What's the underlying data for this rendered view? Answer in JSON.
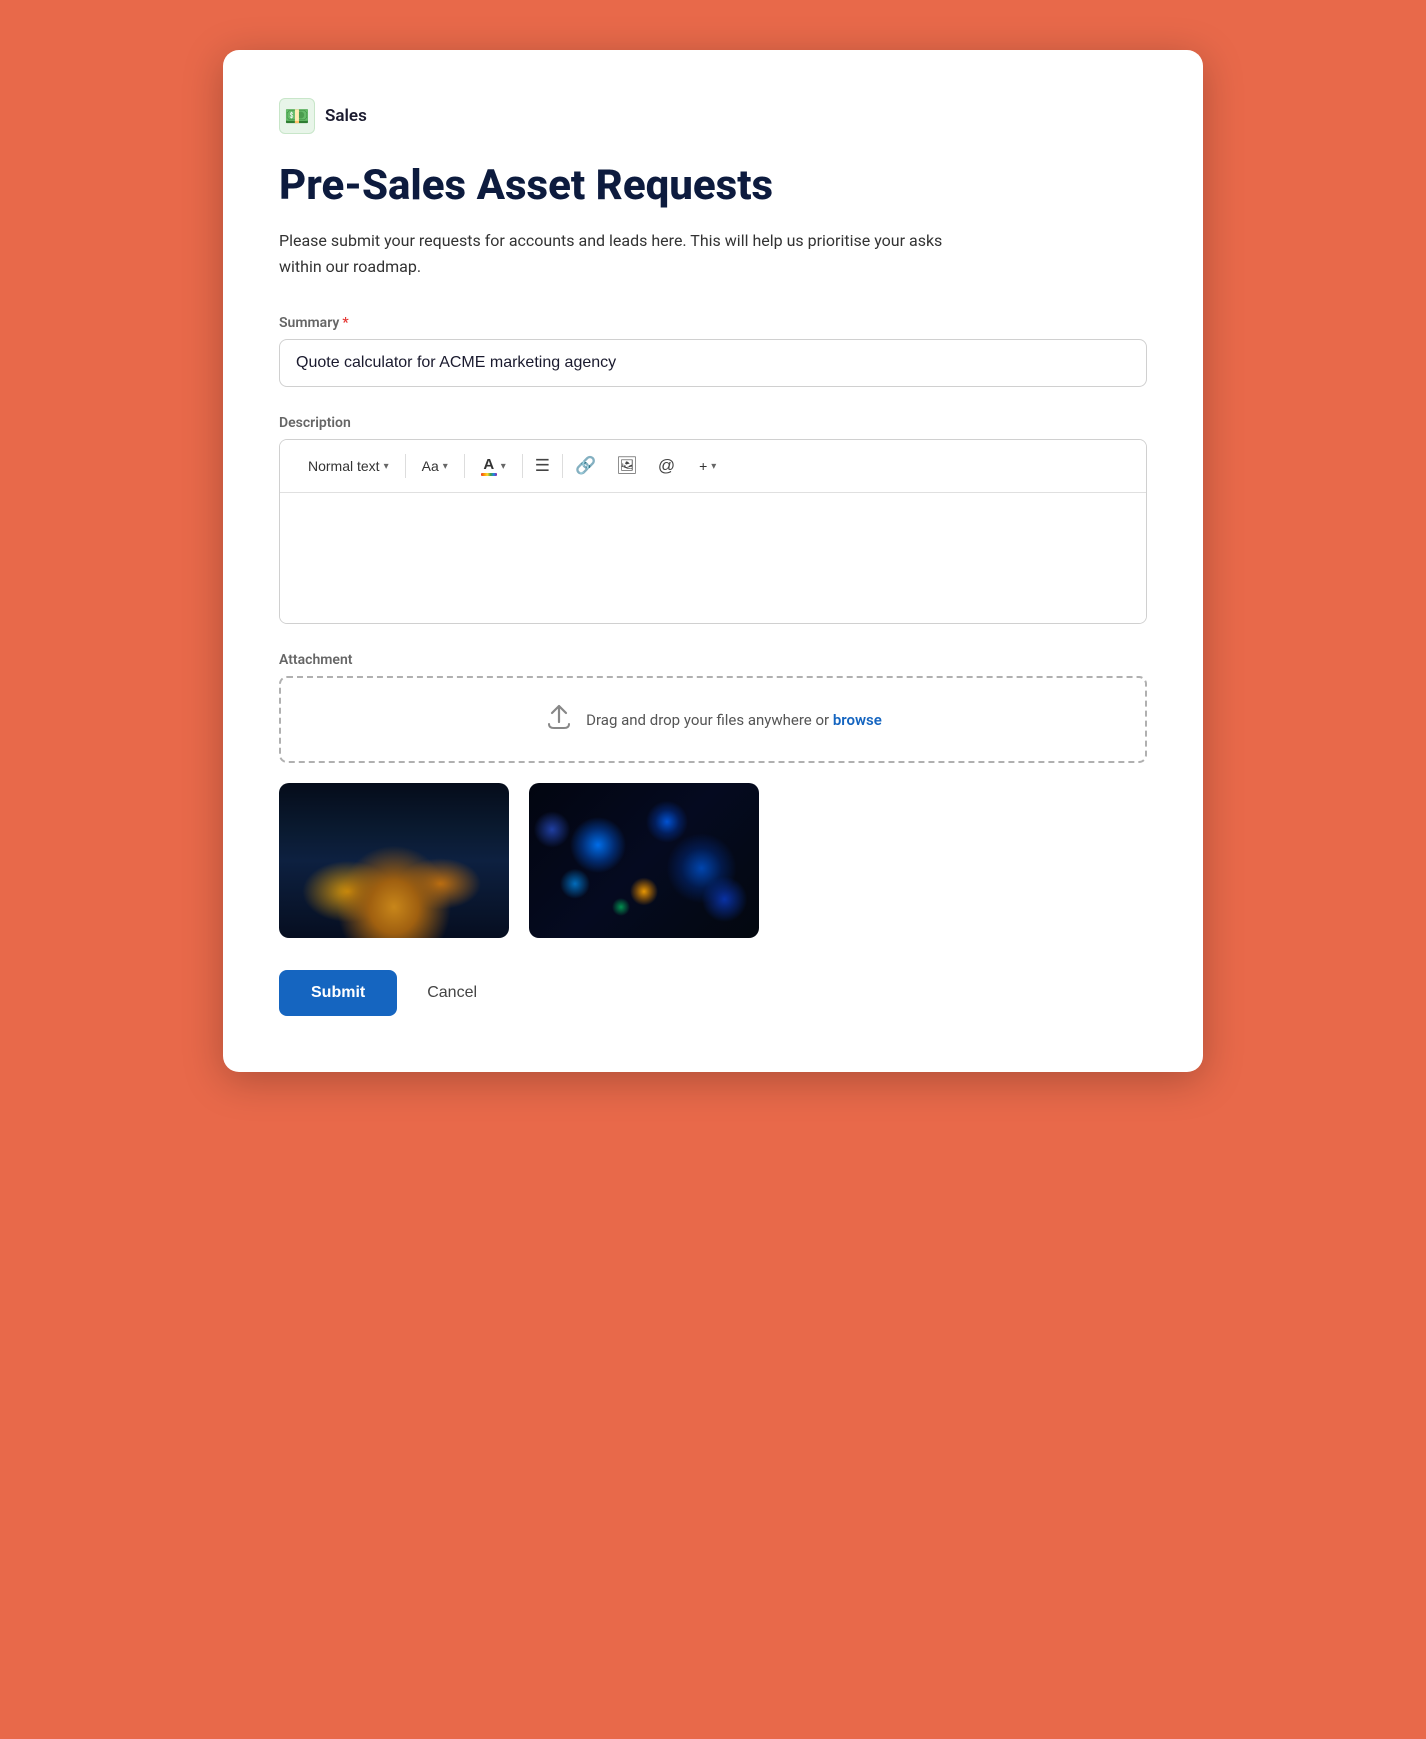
{
  "brand": {
    "icon": "💵",
    "name": "Sales"
  },
  "page": {
    "title": "Pre-Sales Asset Requests",
    "description": "Please submit your requests for accounts and leads here. This will help us prioritise your asks within our roadmap."
  },
  "summary_field": {
    "label": "Summary",
    "required": true,
    "required_symbol": "*",
    "value": "Quote calculator for ACME marketing agency",
    "placeholder": "Quote calculator for ACME marketing agency"
  },
  "description_field": {
    "label": "Description",
    "toolbar": {
      "normal_text_label": "Normal text",
      "font_label": "Aa",
      "list_icon": "☰",
      "link_icon": "🔗",
      "image_icon": "🖼",
      "mention_icon": "@",
      "more_icon": "+"
    }
  },
  "attachment_field": {
    "label": "Attachment",
    "drop_zone_text": "Drag and drop your files anywhere or",
    "browse_label": "browse",
    "thumbnails": [
      {
        "alt": "Night harbor scene",
        "type": "harbor"
      },
      {
        "alt": "Bokeh lights scene",
        "type": "bokeh"
      }
    ]
  },
  "actions": {
    "submit_label": "Submit",
    "cancel_label": "Cancel"
  }
}
